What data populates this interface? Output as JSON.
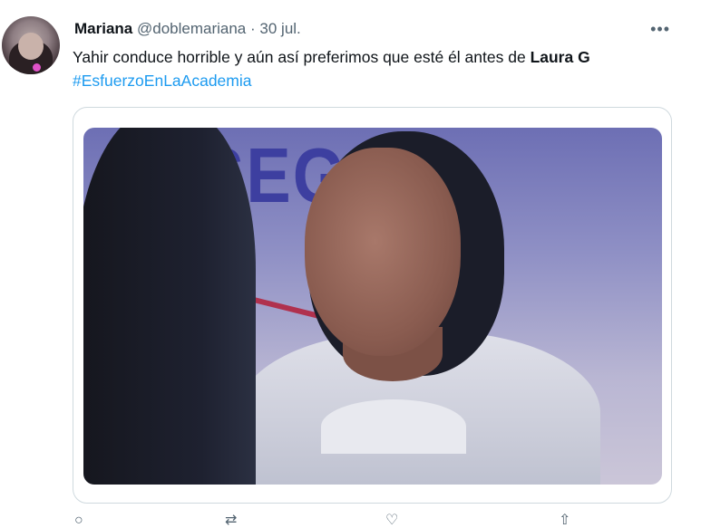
{
  "tweet": {
    "name": "Mariana",
    "handle": "@doblemariana",
    "separator": "·",
    "date": "30 jul.",
    "more": "•••",
    "text_prefix": "Yahir conduce horrible y aún así preferimos que esté él antes de ",
    "text_bold": "Laura G",
    "hashtag": "#EsfuerzoEnLaAcademia"
  },
  "media": {
    "sign_text": "SEG"
  },
  "actions": [
    {
      "name": "reply-icon",
      "glyph": "○"
    },
    {
      "name": "retweet-icon",
      "glyph": "⇄"
    },
    {
      "name": "like-icon",
      "glyph": "♡"
    },
    {
      "name": "share-icon",
      "glyph": "⇧"
    }
  ],
  "colors": {
    "link": "#1d9bf0",
    "secondary": "#536471",
    "border": "#cfd9de"
  }
}
